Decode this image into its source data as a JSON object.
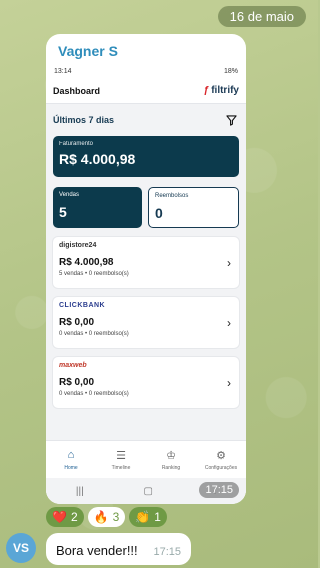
{
  "chat": {
    "date": "16 de maio",
    "sender": "Vagner S",
    "image_time": "17:15",
    "reactions": [
      {
        "emoji": "❤️",
        "count": "2"
      },
      {
        "emoji": "🔥",
        "count": "3"
      },
      {
        "emoji": "👏",
        "count": "1"
      }
    ],
    "avatar_initials": "VS",
    "message_text": "Bora vender!!!",
    "message_time": "17:15"
  },
  "phone": {
    "status_time": "13:14",
    "status_battery": "18%",
    "app_title": "Dashboard",
    "logo_text": "filtrify",
    "period_label": "Últimos 7 dias",
    "total_label": "Faturamento",
    "total_value": "R$ 4.000,98",
    "sales_label": "Vendas",
    "sales_value": "5",
    "refunds_label": "Reembolsos",
    "refunds_value": "0",
    "platforms": [
      {
        "name": "digistore24",
        "value": "R$ 4.000,98",
        "sub": "5 vendas • 0 reembolso(s)"
      },
      {
        "name": "CLICKBANK",
        "value": "R$ 0,00",
        "sub": "0 vendas • 0 reembolso(s)"
      },
      {
        "name": "maxweb",
        "value": "R$ 0,00",
        "sub": "0 vendas • 0 reembolso(s)"
      }
    ],
    "nav": [
      "Home",
      "Timeline",
      "Ranking",
      "Configurações"
    ]
  }
}
